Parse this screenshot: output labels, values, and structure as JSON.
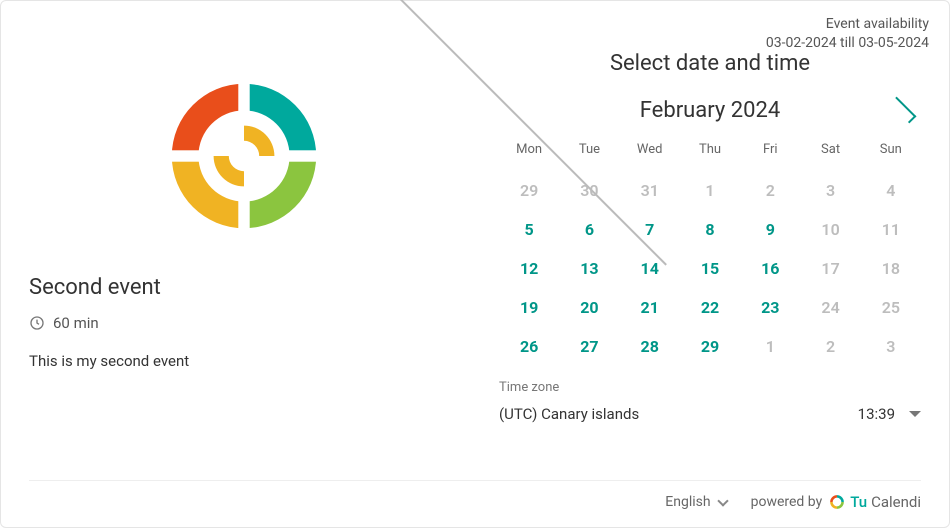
{
  "availability": {
    "label": "Event availability",
    "range": "03-02-2024 till 03-05-2024"
  },
  "event": {
    "title": "Second event",
    "duration": "60 min",
    "description": "This is my second event"
  },
  "step_title": "Select date and time",
  "calendar": {
    "month_label": "February 2024",
    "prev_enabled": false,
    "next_enabled": true,
    "dow": [
      "Mon",
      "Tue",
      "Wed",
      "Thu",
      "Fri",
      "Sat",
      "Sun"
    ],
    "days": [
      {
        "n": "29",
        "state": "unavailable"
      },
      {
        "n": "30",
        "state": "unavailable"
      },
      {
        "n": "31",
        "state": "unavailable"
      },
      {
        "n": "1",
        "state": "unavailable"
      },
      {
        "n": "2",
        "state": "unavailable"
      },
      {
        "n": "3",
        "state": "unavailable"
      },
      {
        "n": "4",
        "state": "unavailable"
      },
      {
        "n": "5",
        "state": "available"
      },
      {
        "n": "6",
        "state": "available"
      },
      {
        "n": "7",
        "state": "available"
      },
      {
        "n": "8",
        "state": "available"
      },
      {
        "n": "9",
        "state": "available"
      },
      {
        "n": "10",
        "state": "unavailable"
      },
      {
        "n": "11",
        "state": "unavailable"
      },
      {
        "n": "12",
        "state": "available"
      },
      {
        "n": "13",
        "state": "available"
      },
      {
        "n": "14",
        "state": "available"
      },
      {
        "n": "15",
        "state": "available"
      },
      {
        "n": "16",
        "state": "available"
      },
      {
        "n": "17",
        "state": "unavailable"
      },
      {
        "n": "18",
        "state": "unavailable"
      },
      {
        "n": "19",
        "state": "available"
      },
      {
        "n": "20",
        "state": "available"
      },
      {
        "n": "21",
        "state": "available"
      },
      {
        "n": "22",
        "state": "available"
      },
      {
        "n": "23",
        "state": "available"
      },
      {
        "n": "24",
        "state": "unavailable"
      },
      {
        "n": "25",
        "state": "unavailable"
      },
      {
        "n": "26",
        "state": "available"
      },
      {
        "n": "27",
        "state": "available"
      },
      {
        "n": "28",
        "state": "available"
      },
      {
        "n": "29",
        "state": "available"
      },
      {
        "n": "1",
        "state": "unavailable"
      },
      {
        "n": "2",
        "state": "unavailable"
      },
      {
        "n": "3",
        "state": "unavailable"
      }
    ]
  },
  "timezone": {
    "label": "Time zone",
    "value": "(UTC) Canary islands",
    "time": "13:39"
  },
  "footer": {
    "language": "English",
    "powered_by": "powered by",
    "brand_a": "Tu",
    "brand_b": "Calendi"
  },
  "colors": {
    "teal": "#00a99d",
    "orange": "#e94e1b",
    "yellow": "#f0b323",
    "green": "#8bc53f"
  }
}
